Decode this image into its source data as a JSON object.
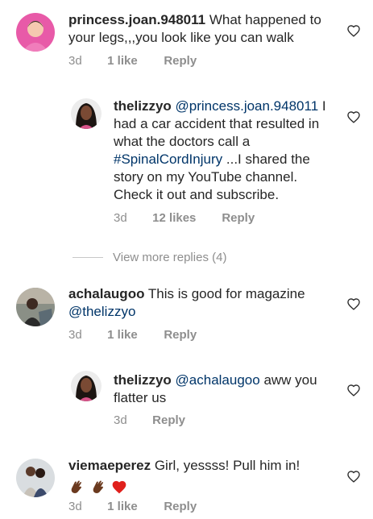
{
  "comments": [
    {
      "username": "princess.joan.948011",
      "text": "What happened to your legs,,,you look like you can walk",
      "time": "3d",
      "likes": "1 like",
      "reply": "Reply"
    },
    {
      "username": "thelizzyo",
      "mention": "@princess.joan.948011",
      "text_before": "I had a car accident that resulted in what the doctors call a",
      "hashtag": "#SpinalCordInjury",
      "text_after": "...I shared the story on my YouTube channel. Check it out and subscribe.",
      "time": "3d",
      "likes": "12 likes",
      "reply": "Reply"
    },
    {
      "username": "achalaugoo",
      "text": "This is good for  magazine",
      "mention": "@thelizzyo",
      "time": "3d",
      "likes": "1 like",
      "reply": "Reply"
    },
    {
      "username": "thelizzyo",
      "mention": "@achalaugoo",
      "text": "aww you flatter us",
      "time": "3d",
      "reply": "Reply"
    },
    {
      "username": "viemaeperez",
      "text": "Girl, yessss! Pull him in!",
      "emojis": [
        "clapping-hands-dark",
        "clapping-hands-dark",
        "red-heart"
      ],
      "time": "3d",
      "likes": "1 like",
      "reply": "Reply"
    }
  ],
  "view_more_replies": "View more replies (4)",
  "colors": {
    "text": "#262626",
    "muted": "#8e8e8e",
    "link": "#003569"
  }
}
